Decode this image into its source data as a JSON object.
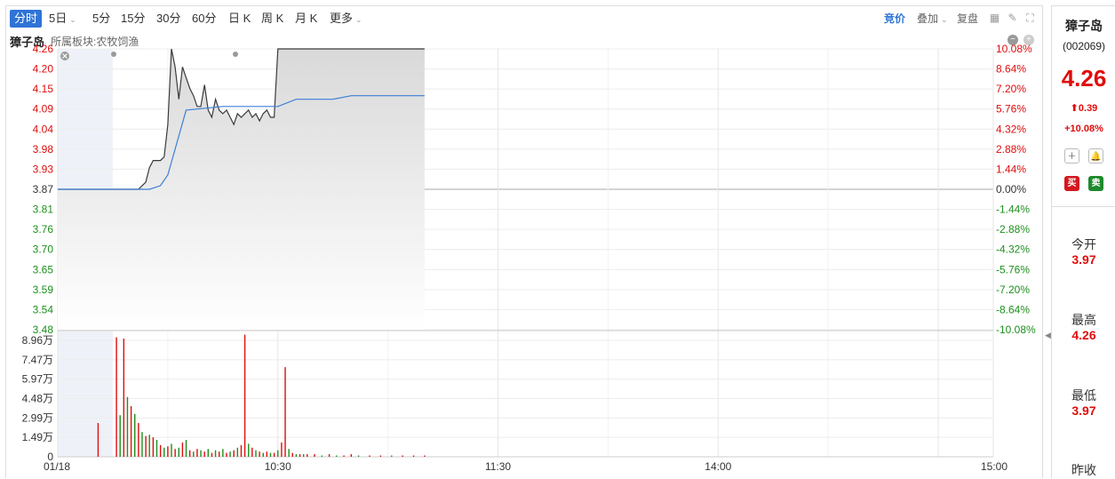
{
  "toolbar": {
    "tabs": [
      {
        "label": "分时",
        "active": true
      },
      {
        "label": "5日",
        "dropdown": true
      },
      {
        "label": "5分"
      },
      {
        "label": "15分"
      },
      {
        "label": "30分"
      },
      {
        "label": "60分"
      },
      {
        "label": "日 K"
      },
      {
        "label": "周 K"
      },
      {
        "label": "月 K"
      },
      {
        "label": "更多",
        "dropdown": true
      }
    ],
    "right": {
      "bid": "竞价",
      "overlay": "叠加",
      "adjust": "复盘"
    },
    "icons": [
      "grid-icon",
      "pencil-icon",
      "fullscreen-icon"
    ]
  },
  "subbar": {
    "stock_name": "獐子岛",
    "sector": "所属板块:农牧饲渔",
    "icons": [
      "minus-circle-icon",
      "plus-circle-icon"
    ]
  },
  "colors": {
    "up": "#e00c0c",
    "down": "#1d8f1d",
    "price_line": "#3a3a3a",
    "avg_line": "#3d7ed6",
    "accent": "#2f74d6"
  },
  "chart_data": [
    {
      "type": "line",
      "name": "intraday-price",
      "prev_close": 3.87,
      "price_ticks": [
        "4.26",
        "4.20",
        "4.15",
        "4.09",
        "4.04",
        "3.98",
        "3.93",
        "3.87",
        "3.81",
        "3.76",
        "3.70",
        "3.65",
        "3.59",
        "3.54",
        "3.48"
      ],
      "pct_ticks": [
        "10.08%",
        "8.64%",
        "7.20%",
        "5.76%",
        "4.32%",
        "2.88%",
        "1.44%",
        "0.00%",
        "-1.44%",
        "-2.88%",
        "-4.32%",
        "-5.76%",
        "-7.20%",
        "-8.64%",
        "-10.08%"
      ],
      "ylim": [
        3.48,
        4.26
      ],
      "x_ticks": [
        "01/18",
        "10:30",
        "11:30",
        "14:00",
        "15:00"
      ],
      "x_range_minutes": [
        0,
        255
      ],
      "series": [
        {
          "name": "price",
          "x": [
            0,
            1,
            2,
            3,
            4,
            5,
            6,
            7,
            8,
            9,
            10,
            11,
            12,
            13,
            14,
            15,
            16,
            17,
            18,
            19,
            20,
            21,
            22,
            23,
            24,
            25,
            26,
            27,
            28,
            29,
            30,
            31,
            32,
            33,
            34,
            35,
            36,
            37,
            38,
            39,
            40,
            41,
            42,
            43,
            44,
            45,
            46,
            47,
            48,
            49,
            50,
            51,
            52,
            53,
            54,
            55,
            56,
            57,
            58,
            59,
            60,
            61,
            62,
            63,
            64,
            65,
            66,
            67,
            68,
            69,
            70,
            71,
            72,
            73,
            74,
            75,
            76,
            77,
            78,
            79,
            80,
            81,
            82,
            83,
            84,
            85,
            86,
            87,
            88,
            89,
            90,
            91,
            92,
            93,
            94,
            95,
            96,
            97,
            98,
            99,
            100
          ],
          "values": [
            3.87,
            3.87,
            3.87,
            3.87,
            3.87,
            3.87,
            3.87,
            3.87,
            3.87,
            3.87,
            3.87,
            3.87,
            3.87,
            3.87,
            3.87,
            3.87,
            3.87,
            3.87,
            3.87,
            3.87,
            3.87,
            3.87,
            3.87,
            3.88,
            3.89,
            3.93,
            3.95,
            3.95,
            3.95,
            3.96,
            4.05,
            4.26,
            4.21,
            4.12,
            4.21,
            4.18,
            4.15,
            4.13,
            4.1,
            4.1,
            4.16,
            4.09,
            4.07,
            4.12,
            4.09,
            4.08,
            4.09,
            4.07,
            4.05,
            4.08,
            4.07,
            4.08,
            4.09,
            4.07,
            4.08,
            4.06,
            4.08,
            4.09,
            4.07,
            4.07,
            4.26,
            4.26,
            4.26,
            4.26,
            4.26,
            4.26,
            4.26,
            4.26,
            4.26,
            4.26,
            4.26,
            4.26,
            4.26,
            4.26,
            4.26,
            4.26,
            4.26,
            4.26,
            4.26,
            4.26,
            4.26,
            4.26,
            4.26,
            4.26,
            4.26,
            4.26,
            4.26,
            4.26,
            4.26,
            4.26,
            4.26,
            4.26,
            4.26,
            4.26,
            4.26,
            4.26,
            4.26,
            4.26,
            4.26,
            4.26,
            4.26
          ]
        },
        {
          "name": "average",
          "x": [
            0,
            10,
            14,
            15,
            17,
            18,
            19,
            20,
            22,
            25,
            28,
            30,
            35,
            45,
            50,
            60,
            65,
            70,
            75,
            80,
            85,
            90,
            95,
            100
          ],
          "values": [
            3.87,
            3.87,
            3.87,
            3.87,
            3.87,
            3.87,
            3.87,
            3.87,
            3.87,
            3.87,
            3.88,
            3.91,
            4.09,
            4.1,
            4.1,
            4.1,
            4.12,
            4.12,
            4.12,
            4.13,
            4.13,
            4.13,
            4.13,
            4.13
          ]
        }
      ]
    },
    {
      "type": "bar",
      "name": "volume",
      "unit": "万",
      "y_ticks": [
        "8.96万",
        "7.47万",
        "5.97万",
        "4.48万",
        "2.99万",
        "1.49万",
        "0"
      ],
      "ylim": [
        0,
        8.96
      ],
      "x_range_minutes": [
        0,
        255
      ],
      "bars": [
        {
          "x": 11,
          "v": 2.6,
          "c": "up"
        },
        {
          "x": 16,
          "v": 9.2,
          "c": "up"
        },
        {
          "x": 17,
          "v": 3.2,
          "c": "down"
        },
        {
          "x": 18,
          "v": 9.1,
          "c": "up"
        },
        {
          "x": 19,
          "v": 4.6,
          "c": "down"
        },
        {
          "x": 20,
          "v": 3.9,
          "c": "up"
        },
        {
          "x": 21,
          "v": 3.3,
          "c": "down"
        },
        {
          "x": 22,
          "v": 2.6,
          "c": "up"
        },
        {
          "x": 23,
          "v": 1.9,
          "c": "down"
        },
        {
          "x": 24,
          "v": 1.6,
          "c": "up"
        },
        {
          "x": 25,
          "v": 1.7,
          "c": "down"
        },
        {
          "x": 26,
          "v": 1.5,
          "c": "up"
        },
        {
          "x": 27,
          "v": 1.3,
          "c": "down"
        },
        {
          "x": 28,
          "v": 0.9,
          "c": "up"
        },
        {
          "x": 29,
          "v": 0.7,
          "c": "down"
        },
        {
          "x": 30,
          "v": 0.8,
          "c": "up"
        },
        {
          "x": 31,
          "v": 1.0,
          "c": "down"
        },
        {
          "x": 32,
          "v": 0.6,
          "c": "up"
        },
        {
          "x": 33,
          "v": 0.7,
          "c": "down"
        },
        {
          "x": 34,
          "v": 1.1,
          "c": "up"
        },
        {
          "x": 35,
          "v": 1.3,
          "c": "down"
        },
        {
          "x": 36,
          "v": 0.5,
          "c": "up"
        },
        {
          "x": 37,
          "v": 0.4,
          "c": "down"
        },
        {
          "x": 38,
          "v": 0.6,
          "c": "up"
        },
        {
          "x": 39,
          "v": 0.5,
          "c": "down"
        },
        {
          "x": 40,
          "v": 0.4,
          "c": "up"
        },
        {
          "x": 41,
          "v": 0.6,
          "c": "down"
        },
        {
          "x": 42,
          "v": 0.3,
          "c": "up"
        },
        {
          "x": 43,
          "v": 0.5,
          "c": "down"
        },
        {
          "x": 44,
          "v": 0.4,
          "c": "up"
        },
        {
          "x": 45,
          "v": 0.6,
          "c": "down"
        },
        {
          "x": 46,
          "v": 0.3,
          "c": "up"
        },
        {
          "x": 47,
          "v": 0.4,
          "c": "down"
        },
        {
          "x": 48,
          "v": 0.5,
          "c": "up"
        },
        {
          "x": 49,
          "v": 0.7,
          "c": "down"
        },
        {
          "x": 50,
          "v": 0.9,
          "c": "up"
        },
        {
          "x": 51,
          "v": 9.4,
          "c": "up"
        },
        {
          "x": 52,
          "v": 1.0,
          "c": "down"
        },
        {
          "x": 53,
          "v": 0.7,
          "c": "up"
        },
        {
          "x": 54,
          "v": 0.5,
          "c": "down"
        },
        {
          "x": 55,
          "v": 0.4,
          "c": "up"
        },
        {
          "x": 56,
          "v": 0.3,
          "c": "down"
        },
        {
          "x": 57,
          "v": 0.4,
          "c": "up"
        },
        {
          "x": 58,
          "v": 0.3,
          "c": "down"
        },
        {
          "x": 59,
          "v": 0.3,
          "c": "up"
        },
        {
          "x": 60,
          "v": 0.5,
          "c": "down"
        },
        {
          "x": 61,
          "v": 1.1,
          "c": "up"
        },
        {
          "x": 62,
          "v": 6.9,
          "c": "up"
        },
        {
          "x": 63,
          "v": 0.6,
          "c": "down"
        },
        {
          "x": 64,
          "v": 0.3,
          "c": "up"
        },
        {
          "x": 65,
          "v": 0.2,
          "c": "down"
        },
        {
          "x": 66,
          "v": 0.2,
          "c": "up"
        },
        {
          "x": 67,
          "v": 0.2,
          "c": "down"
        },
        {
          "x": 68,
          "v": 0.2,
          "c": "up"
        },
        {
          "x": 70,
          "v": 0.2,
          "c": "up"
        },
        {
          "x": 72,
          "v": 0.1,
          "c": "down"
        },
        {
          "x": 74,
          "v": 0.2,
          "c": "up"
        },
        {
          "x": 76,
          "v": 0.1,
          "c": "down"
        },
        {
          "x": 78,
          "v": 0.1,
          "c": "up"
        },
        {
          "x": 80,
          "v": 0.2,
          "c": "up"
        },
        {
          "x": 82,
          "v": 0.1,
          "c": "down"
        },
        {
          "x": 85,
          "v": 0.1,
          "c": "up"
        },
        {
          "x": 88,
          "v": 0.1,
          "c": "up"
        },
        {
          "x": 91,
          "v": 0.1,
          "c": "down"
        },
        {
          "x": 94,
          "v": 0.1,
          "c": "up"
        },
        {
          "x": 97,
          "v": 0.1,
          "c": "up"
        },
        {
          "x": 100,
          "v": 0.1,
          "c": "up"
        }
      ]
    }
  ],
  "sidebar": {
    "name": "獐子岛",
    "code": "(002069)",
    "price": "4.26",
    "change": "0.39",
    "change_pct": "+10.08%",
    "buy": "买",
    "sell": "卖",
    "stats": [
      {
        "label": "今开",
        "value": "3.97"
      },
      {
        "label": "最高",
        "value": "4.26"
      },
      {
        "label": "最低",
        "value": "3.97"
      },
      {
        "label": "昨收",
        "value": ""
      }
    ]
  }
}
